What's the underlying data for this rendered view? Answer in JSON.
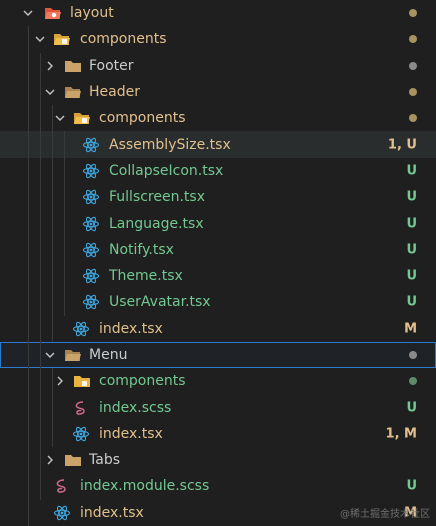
{
  "colors": {
    "modified": "#e2c08d",
    "untracked": "#73c991",
    "default": "#cccccc",
    "react": "#3fa7e0",
    "scss": "#d16a8a",
    "folder": "#c9a36a",
    "folder_special": "#e8b441",
    "dot_modified": "#a89260",
    "dot_gray": "#8a8a8a",
    "dot_green": "#5f8a6a"
  },
  "rows": [
    {
      "label": "layout",
      "status": ""
    },
    {
      "label": "components",
      "status": ""
    },
    {
      "label": "Footer",
      "status": ""
    },
    {
      "label": "Header",
      "status": ""
    },
    {
      "label": "components",
      "status": ""
    },
    {
      "label": "AssemblySize.tsx",
      "status": "1, U"
    },
    {
      "label": "CollapseIcon.tsx",
      "status": "U"
    },
    {
      "label": "Fullscreen.tsx",
      "status": "U"
    },
    {
      "label": "Language.tsx",
      "status": "U"
    },
    {
      "label": "Notify.tsx",
      "status": "U"
    },
    {
      "label": "Theme.tsx",
      "status": "U"
    },
    {
      "label": "UserAvatar.tsx",
      "status": "U"
    },
    {
      "label": "index.tsx",
      "status": "M"
    },
    {
      "label": "Menu",
      "status": ""
    },
    {
      "label": "components",
      "status": ""
    },
    {
      "label": "index.scss",
      "status": "U"
    },
    {
      "label": "index.tsx",
      "status": "1, M"
    },
    {
      "label": "Tabs",
      "status": ""
    },
    {
      "label": "index.module.scss",
      "status": "U"
    },
    {
      "label": "index.tsx",
      "status": "M"
    }
  ],
  "watermark": "@稀土掘金技术社区"
}
